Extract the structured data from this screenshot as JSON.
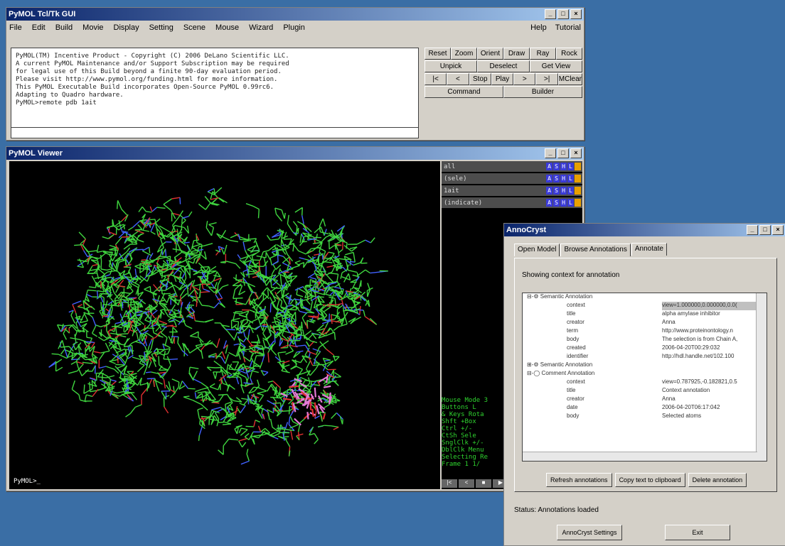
{
  "gui": {
    "title": "PyMOL Tcl/Tk GUI",
    "menu": [
      "File",
      "Edit",
      "Build",
      "Movie",
      "Display",
      "Setting",
      "Scene",
      "Mouse",
      "Wizard",
      "Plugin"
    ],
    "menu_right": [
      "Help",
      "Tutorial"
    ],
    "console": [
      "PyMOL(TM) Incentive Product - Copyright (C) 2006 DeLano Scientific LLC.",
      "",
      "A current PyMOL Maintenance and/or Support Subscription may be required",
      "for legal use of this Build beyond a finite 90-day evaluation period.",
      "Please visit http://www.pymol.org/funding.html for more information.",
      "",
      "This PyMOL Executable Build incorporates Open-Source PyMOL 0.99rc6.",
      "Adapting to Quadro hardware.",
      "PyMOL>remote pdb 1ait"
    ],
    "buttons_row1": [
      "Reset",
      "Zoom",
      "Orient",
      "Draw",
      "Ray",
      "Rock"
    ],
    "buttons_row2": [
      "Unpick",
      "Deselect",
      "Get View"
    ],
    "buttons_row3": [
      "|<",
      "<",
      "Stop",
      "Play",
      ">",
      ">|",
      "MClear"
    ],
    "buttons_row4": [
      "Command",
      "Builder"
    ]
  },
  "viewer": {
    "title": "PyMOL Viewer",
    "prompt": "PyMOL>_",
    "objects": [
      {
        "name": "all"
      },
      {
        "name": "(sele)"
      },
      {
        "name": "1ait"
      },
      {
        "name": "(indicate)"
      }
    ],
    "object_buttons": [
      "A",
      "S",
      "H",
      "L"
    ],
    "mouse_panel": [
      "Mouse Mode 3",
      "Buttons  L",
      " & Keys Rota",
      "   Shft +Box",
      "   Ctrl +/-",
      "   CtSh Sele",
      " SnglClk +/-",
      " DblClk Menu",
      "Selecting Re",
      "Frame  1  1/"
    ],
    "play_buttons": [
      "|<",
      "<",
      "■",
      "▶"
    ]
  },
  "anno": {
    "title": "AnnoCryst",
    "tabs": [
      "Open Model",
      "Browse Annotations",
      "Annotate"
    ],
    "showing": "Showing context for annotation",
    "tree": [
      {
        "type": "hdr",
        "k": "⊟-⚙ Semantic Annotation",
        "v": ""
      },
      {
        "type": "child",
        "k": "context",
        "v": "view=1.000000,0.000000,0.0(",
        "sel": true
      },
      {
        "type": "child",
        "k": "title",
        "v": "alpha amylase inhibitor"
      },
      {
        "type": "child",
        "k": "creator",
        "v": "Anna"
      },
      {
        "type": "child",
        "k": "term",
        "v": "http://www.proteinontology.n"
      },
      {
        "type": "child",
        "k": "body",
        "v": "The selection is from Chain A,"
      },
      {
        "type": "child",
        "k": "created",
        "v": "2006-04-20T00:29:032"
      },
      {
        "type": "child",
        "k": "identifier",
        "v": "http://hdl.handle.net/102.100"
      },
      {
        "type": "hdr",
        "k": "⊞-⚙ Semantic Annotation",
        "v": ""
      },
      {
        "type": "hdr",
        "k": "⊟-◯ Comment Annotation",
        "v": ""
      },
      {
        "type": "child",
        "k": "context",
        "v": "view=0.787925,-0.182821,0.5"
      },
      {
        "type": "child",
        "k": "title",
        "v": "Context annotation"
      },
      {
        "type": "child",
        "k": "creator",
        "v": "Anna"
      },
      {
        "type": "child",
        "k": "date",
        "v": "2006-04-20T06:17:042"
      },
      {
        "type": "child",
        "k": "body",
        "v": "Selected atoms"
      }
    ],
    "buttons": [
      "Refresh annotations",
      "Copy text to clipboard",
      "Delete annotation"
    ],
    "status": "Status:   Annotations loaded",
    "bottom_buttons": [
      "AnnoCryst Settings",
      "Exit"
    ]
  },
  "colors": {
    "desktop": "#3a6ea5",
    "carbon": "#3fd53f",
    "nitrogen": "#4060ff",
    "oxygen": "#e03030",
    "ligand": "#e47ad6"
  }
}
